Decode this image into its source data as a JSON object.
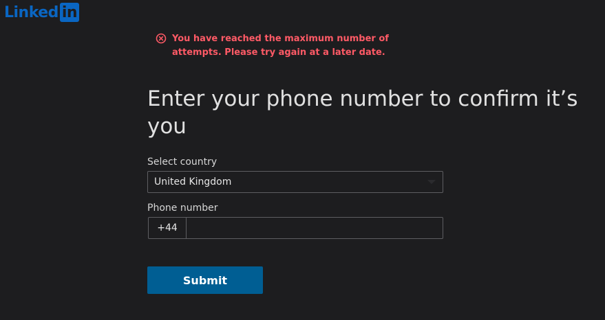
{
  "logo": {
    "text": "Linked",
    "badge": "in",
    "color": "#0a66c2"
  },
  "error": {
    "icon": "error-circle-x-icon",
    "message": "You have reached the maximum number of attempts. Please try again at a later date.",
    "color": "#ff5a66"
  },
  "heading": "Enter your phone number to confirm it’s you",
  "country": {
    "label": "Select country",
    "value": "United Kingdom",
    "icon": "chevron-down-icon"
  },
  "phone": {
    "label": "Phone number",
    "prefix": "+44",
    "value": ""
  },
  "submit": {
    "label": "Submit",
    "color": "#005e93"
  }
}
